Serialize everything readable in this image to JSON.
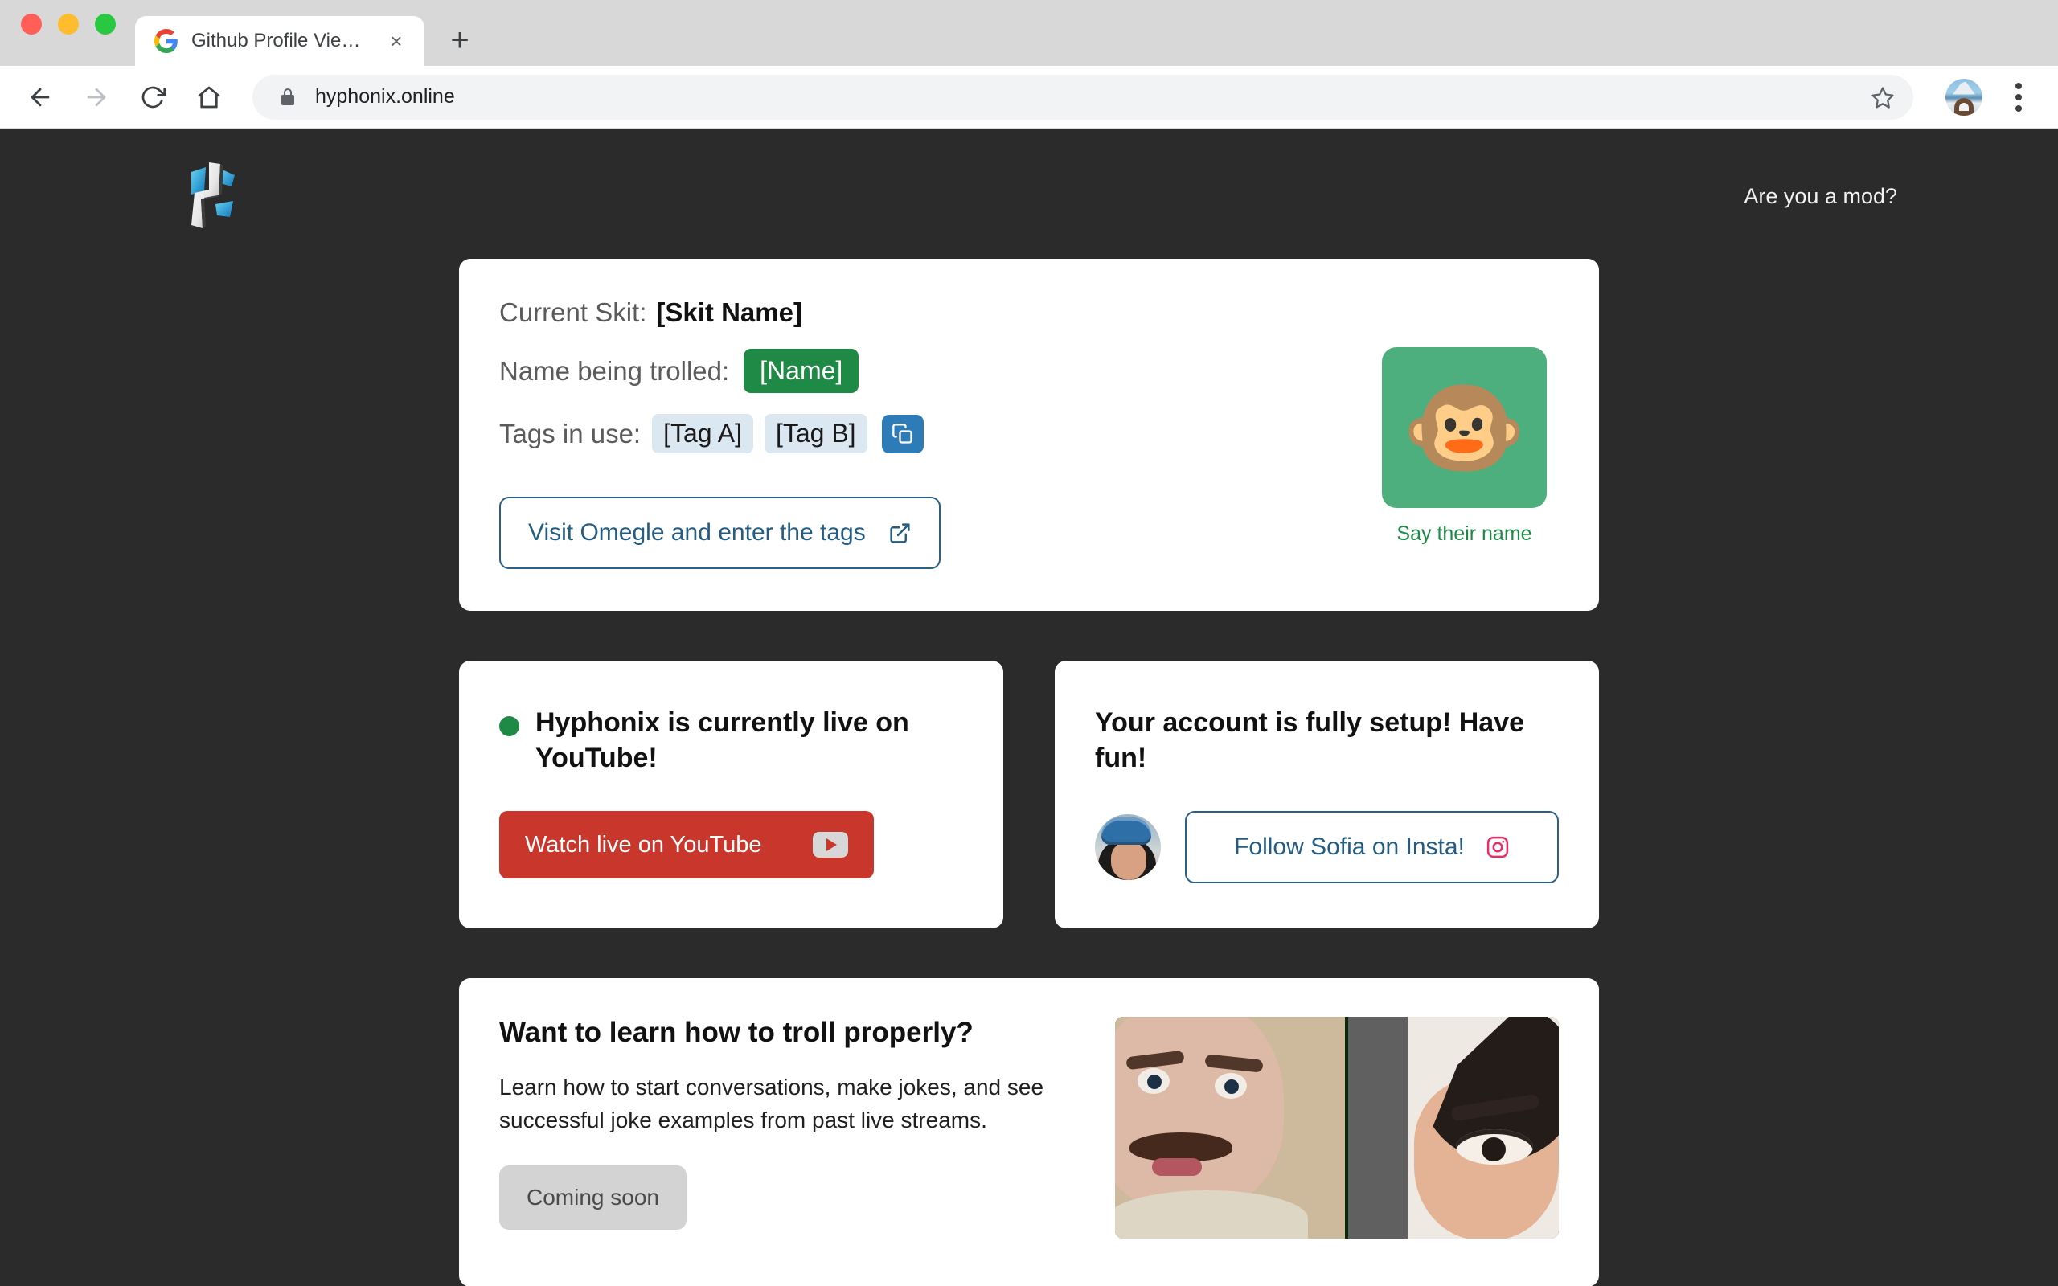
{
  "browser": {
    "tab": {
      "title": "Github Profile Viewer",
      "favicon": "google-g-icon",
      "close": "×"
    },
    "new_tab": "+",
    "nav": {
      "back": "←",
      "forward": "→",
      "reload": "⟳",
      "home": "⌂"
    },
    "omnibox": {
      "lock": "lock-icon",
      "url": "hyphonix.online",
      "star": "☆"
    },
    "menu": "kebab-menu-icon"
  },
  "page": {
    "header": {
      "logo_alt": "hyphonix-logo",
      "mod_link": "Are you a mod?"
    },
    "main_card": {
      "skit_label": "Current Skit:",
      "skit_value": "[Skit Name]",
      "name_label": "Name being trolled:",
      "name_value": "[Name]",
      "tags_label": "Tags in use:",
      "tags": [
        "[Tag A]",
        "[Tag B]"
      ],
      "copy_icon": "copy-icon",
      "omegle_button": "Visit Omegle and enter the tags",
      "omegle_icon": "external-link-icon",
      "monkey_emoji": "🐵",
      "monkey_caption": "Say their name"
    },
    "live_card": {
      "status_dot": "live-indicator",
      "heading": "Hyphonix is currently live on YouTube!",
      "button_label": "Watch live on YouTube",
      "button_icon": "youtube-icon"
    },
    "account_card": {
      "heading": "Your account is fully setup! Have fun!",
      "avatar_alt": "sofia-avatar",
      "button_label": "Follow Sofia on Insta!",
      "button_icon": "instagram-icon"
    },
    "learn_card": {
      "title": "Want to learn how to troll properly?",
      "description": "Learn how to start conversations, make jokes, and see successful joke examples from past live streams.",
      "button_label": "Coming soon",
      "thumbnail_alt": "split-screen-stream-thumbnail"
    }
  },
  "colors": {
    "page_bg": "#2b2b2b",
    "card_bg": "#ffffff",
    "green": "#1f8a46",
    "monkey_tile": "#4caf7d",
    "tag_bg": "#dbe7f1",
    "copy_blue": "#2d7cb8",
    "link_blue": "#245c82",
    "youtube_red": "#c9372c",
    "instagram_pink": "#ec2c63",
    "disabled_gray": "#d3d3d3"
  }
}
